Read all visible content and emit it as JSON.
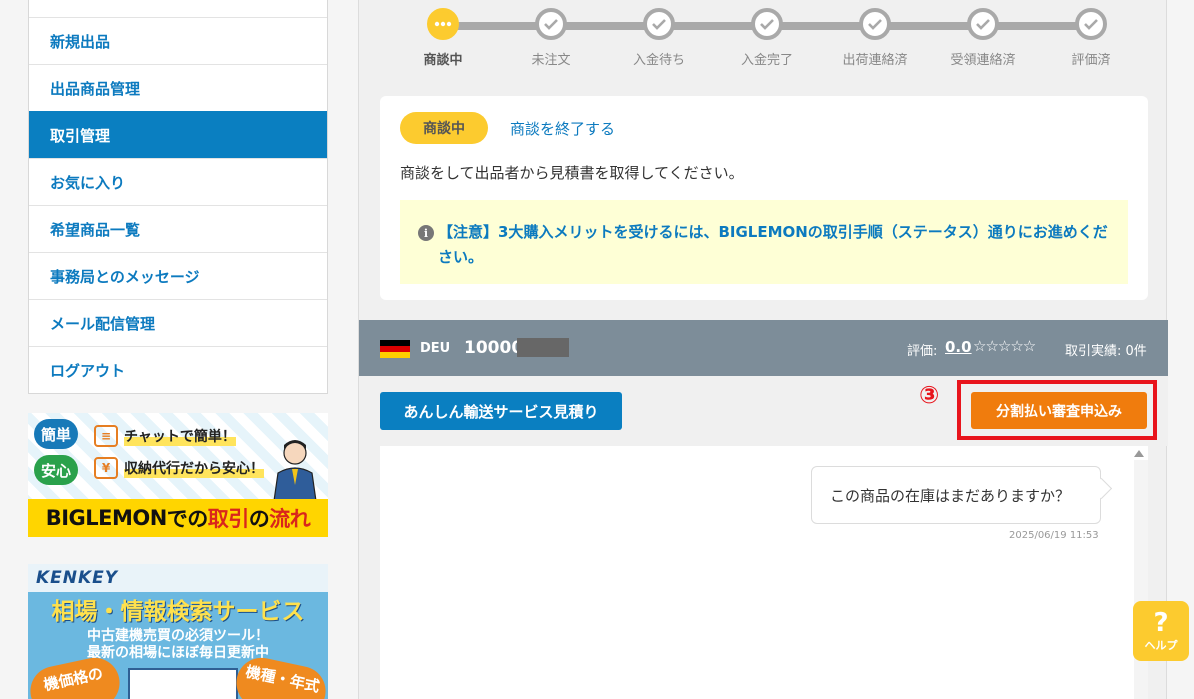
{
  "sidebar": {
    "items": [
      {
        "label": "新規出品"
      },
      {
        "label": "出品商品管理"
      },
      {
        "label": "取引管理"
      },
      {
        "label": "お気に入り"
      },
      {
        "label": "希望商品一覧"
      },
      {
        "label": "事務局とのメッセージ"
      },
      {
        "label": "メール配信管理"
      },
      {
        "label": "ログアウト"
      }
    ],
    "active": "取引管理"
  },
  "banner_flow": {
    "tag_easy": "簡単",
    "tag_safe": "安心",
    "line1": "チャットで簡単！",
    "line2": "収納代行だから安心！",
    "footer_a": "BIGLEMON",
    "footer_b": "での",
    "footer_c": "取引",
    "footer_d": "の",
    "footer_e": "流れ"
  },
  "banner_kenkey": {
    "logo": "KENKEY",
    "title": "相場・情報検索サービス",
    "sub1": "中古建機売買の必須ツール！",
    "sub2": "最新の相場にほぼ毎日更新中",
    "pill_left": "機価格の",
    "pill_right": "機種・年式"
  },
  "stepper": {
    "steps": [
      {
        "label": "商談中",
        "state": "current"
      },
      {
        "label": "未注文",
        "state": "pending"
      },
      {
        "label": "入金待ち",
        "state": "pending"
      },
      {
        "label": "入金完了",
        "state": "pending"
      },
      {
        "label": "出荷連絡済",
        "state": "pending"
      },
      {
        "label": "受領連絡済",
        "state": "pending"
      },
      {
        "label": "評価済",
        "state": "pending"
      }
    ]
  },
  "status": {
    "badge": "商談中",
    "end_link": "商談を終了する",
    "instruction": "商談をして出品者から見積書を取得してください。",
    "notice": "【注意】3大購入メリットを受けるには、BIGLEMONの取引手順（ステータス）通りにお進めください。"
  },
  "seller": {
    "country_code": "DEU",
    "id_visible": "10000",
    "rating_label": "評価:",
    "rating_value": "0.0",
    "stars": "☆☆☆☆☆",
    "record": "取引実績: 0件"
  },
  "actions": {
    "shipping_estimate": "あんしん輸送サービス見積り",
    "annotation": "③",
    "installment_apply": "分割払い審査申込み"
  },
  "chat": {
    "messages": [
      {
        "text": "この商品の在庫はまだありますか？",
        "time": "2025/06/19 11:53"
      }
    ]
  },
  "help": {
    "icon": "?",
    "label": "ヘルプ"
  },
  "colors": {
    "primary_blue": "#0a7fc1",
    "status_yellow": "#fccb2f",
    "action_orange": "#f07c0d",
    "annotation_red": "#e8141c",
    "seller_bar": "#7d8d99"
  }
}
